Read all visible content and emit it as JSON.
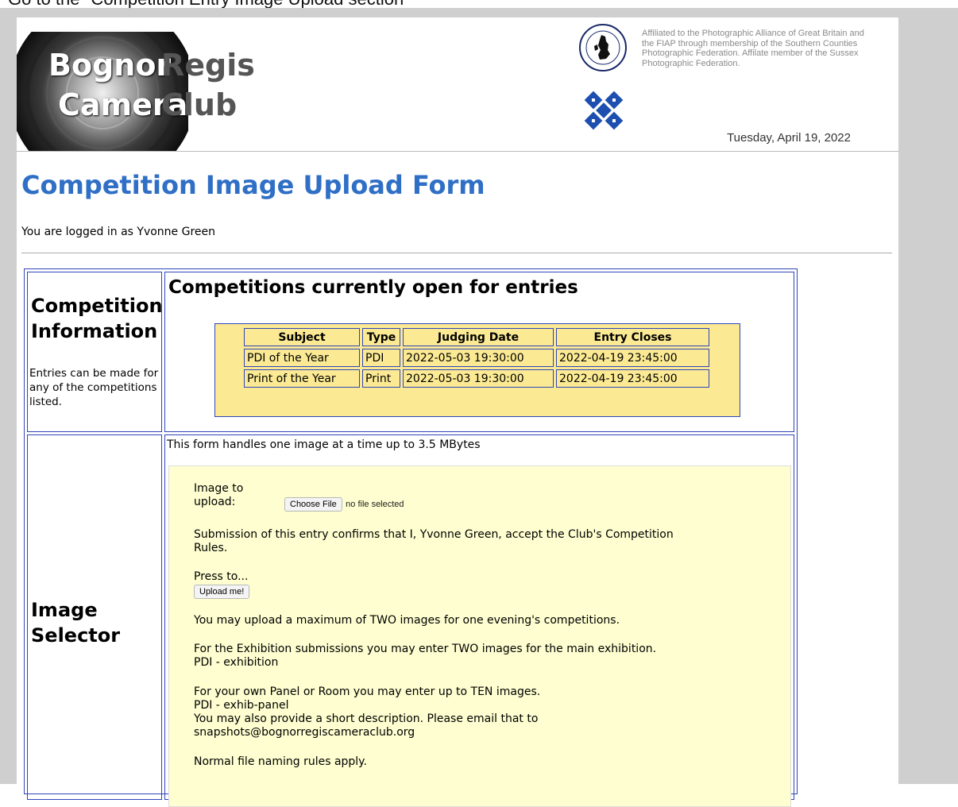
{
  "instruction": "Go to the \"Competition Entry Image Upload section\"",
  "header": {
    "logo_word1": "Bognor",
    "logo_word2": "Regis",
    "logo_word3": "Camera",
    "logo_word4": "Club",
    "affiliation": "Affiliated to the Photographic Alliance of Great Britain and the FIAP through membership of the Southern Counties Photographic Federation. Affilate member of the Sussex Photographic Federation.",
    "date": "Tuesday, April 19, 2022"
  },
  "page": {
    "title": "Competition Image Upload Form",
    "logged_in": "You are logged in as Yvonne Green"
  },
  "competition_info": {
    "heading_line1": "Competition",
    "heading_line2": "Information",
    "note": "Entries can be made for any of the competitions listed.",
    "open_heading": "Competitions currently open for entries",
    "columns": [
      "Subject",
      "Type",
      "Judging Date",
      "Entry Closes"
    ],
    "rows": [
      [
        "PDI of the Year",
        "PDI",
        "2022-05-03 19:30:00",
        "2022-04-19 23:45:00"
      ],
      [
        "Print of the Year",
        "Print",
        "2022-05-03 19:30:00",
        "2022-04-19 23:45:00"
      ]
    ]
  },
  "image_selector": {
    "heading_line1": "Image",
    "heading_line2": "Selector",
    "intro": "This form handles one image at a time up to 3.5 MBytes",
    "image_label_1": "Image to",
    "image_label_2": "upload:",
    "choose_file": "Choose File",
    "no_file": "no file selected",
    "confirm_1": "Submission of this entry confirms that I, Yvonne Green, accept the Club's Competition",
    "confirm_2": "Rules.",
    "press_to": "Press to...",
    "upload_button": "Upload me!",
    "max_note": "You may upload a maximum of TWO images for one evening's competitions.",
    "exhib_1": "For the Exhibition submissions you may enter TWO images for the main exhibition.",
    "exhib_2": "PDI - exhibition",
    "panel_1": "For your own Panel or Room you may enter up to TEN images.",
    "panel_2": "PDI - exhib-panel",
    "panel_3": "You may also provide a short description. Please email that to",
    "email": "snapshots@bognorregiscameraclub.org",
    "naming": "Normal file naming rules apply."
  }
}
